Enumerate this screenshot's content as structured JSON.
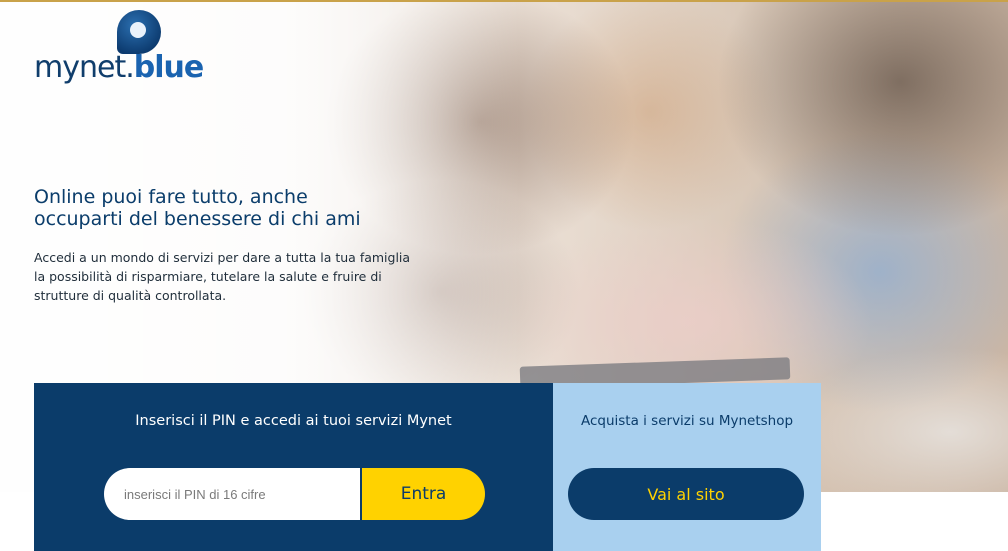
{
  "brand": {
    "logo_part1": "mynet.",
    "logo_part2": "blue"
  },
  "hero": {
    "headline": "Online puoi fare tutto, anche occuparti del benessere di chi ami",
    "subtext": "Accedi a un mondo di servizi per dare a tutta la tua famiglia la possibilità di risparmiare, tutelare la salute e fruire di strutture di qualità controllata."
  },
  "pin_panel": {
    "title": "Inserisci il PIN e accedi ai tuoi servizi Mynet",
    "placeholder": "inserisci il PIN di 16 cifre",
    "value": "",
    "button_label": "Entra"
  },
  "shop_panel": {
    "title": "Acquista i servizi su Mynetshop",
    "button_label": "Vai al sito"
  },
  "colors": {
    "navy": "#0b3c6a",
    "yellow": "#ffd200",
    "light_blue": "#a9d0ef",
    "logo_blue": "#1a63b0"
  }
}
